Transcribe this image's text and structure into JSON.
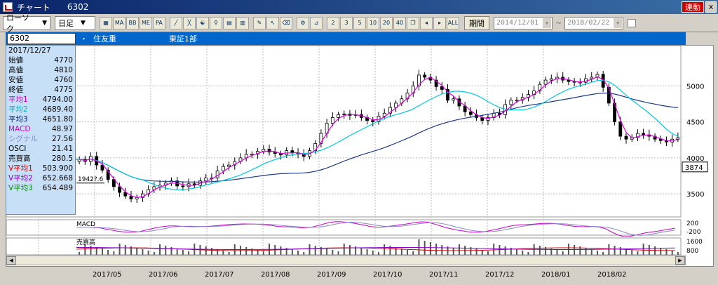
{
  "window": {
    "title": "チャート",
    "code": "6302",
    "link_badge": "連動",
    "close_label": "x"
  },
  "toolbar": {
    "chart_type": "ローソク",
    "interval": "日足",
    "period_button": "期間",
    "date_from": "2014/12/01",
    "date_to": "2018/02/22",
    "range_sep": "~"
  },
  "info": {
    "code": "6302",
    "dot": "・",
    "company": "住友重",
    "market": "東証1部"
  },
  "panel": {
    "date": "2017/12/27",
    "rows": [
      {
        "label": "始値",
        "value": "4770",
        "color": "#000000"
      },
      {
        "label": "高値",
        "value": "4810",
        "color": "#000000"
      },
      {
        "label": "安値",
        "value": "4760",
        "color": "#000000"
      },
      {
        "label": "終値",
        "value": "4775",
        "color": "#000000"
      },
      {
        "label": "平均1",
        "value": "4794.00",
        "color": "#cc00cc"
      },
      {
        "label": "平均2",
        "value": "4689.40",
        "color": "#00b0c8"
      },
      {
        "label": "平均3",
        "value": "4651.80",
        "color": "#00207a"
      },
      {
        "label": "MACD",
        "value": "48.97",
        "color": "#cc00cc"
      },
      {
        "label": "シグナル",
        "value": "27.56",
        "color": "#8888cc"
      },
      {
        "label": "OSCI",
        "value": "21.41",
        "color": "#000000"
      },
      {
        "label": "売買高",
        "value": "280.5",
        "color": "#000000"
      },
      {
        "label": "V平均1",
        "value": "503.900",
        "color": "#cc0000"
      },
      {
        "label": "V平均2",
        "value": "652.668",
        "color": "#8800cc"
      },
      {
        "label": "V平均3",
        "value": "654.489",
        "color": "#008800"
      }
    ]
  },
  "chart_data": {
    "type": "candlestick",
    "price_axis": {
      "ticks": [
        3500,
        4000,
        4500,
        5000
      ],
      "ylim": [
        3180,
        5500
      ],
      "current_value_label": "3874"
    },
    "macd_axis": {
      "ticks": [
        "200",
        "-200"
      ]
    },
    "volume_axis": {
      "ticks": [
        "1600",
        "800"
      ]
    },
    "panel_labels": {
      "macd": "MACD",
      "volume": "売買高"
    },
    "x_labels": [
      "2017/05",
      "2017/06",
      "2017/07",
      "2017/08",
      "2017/09",
      "2017/10",
      "2017/11",
      "2017/12",
      "2018/01",
      "2018/02"
    ],
    "annotation": {
      "label": "1942?.6",
      "value": 3650
    },
    "colors": {
      "ma1": "#dd00dd",
      "ma2": "#00c8e0",
      "ma3": "#1a3a8a"
    },
    "close": [
      3980,
      3950,
      4020,
      3900,
      3830,
      3700,
      3600,
      3520,
      3470,
      3430,
      3450,
      3500,
      3560,
      3600,
      3620,
      3650,
      3680,
      3610,
      3600,
      3640,
      3620,
      3680,
      3720,
      3720,
      3820,
      3880,
      3900,
      3950,
      4000,
      4050,
      4050,
      4090,
      4120,
      4080,
      4060,
      4040,
      4100,
      4070,
      4050,
      4020,
      4100,
      4200,
      4340,
      4480,
      4560,
      4600,
      4610,
      4590,
      4600,
      4560,
      4520,
      4500,
      4580,
      4620,
      4700,
      4760,
      4820,
      4900,
      5000,
      5150,
      5120,
      5080,
      4990,
      4950,
      4800,
      4820,
      4720,
      4640,
      4600,
      4560,
      4520,
      4560,
      4620,
      4600,
      4740,
      4800,
      4800,
      4840,
      4880,
      4930,
      5020,
      5080,
      5100,
      5120,
      5080,
      5060,
      5050,
      5050,
      5100,
      5120,
      5160,
      4980,
      4760,
      4500,
      4300,
      4260,
      4280,
      4340,
      4320,
      4300,
      4260,
      4240,
      4220,
      4260,
      4280
    ]
  }
}
